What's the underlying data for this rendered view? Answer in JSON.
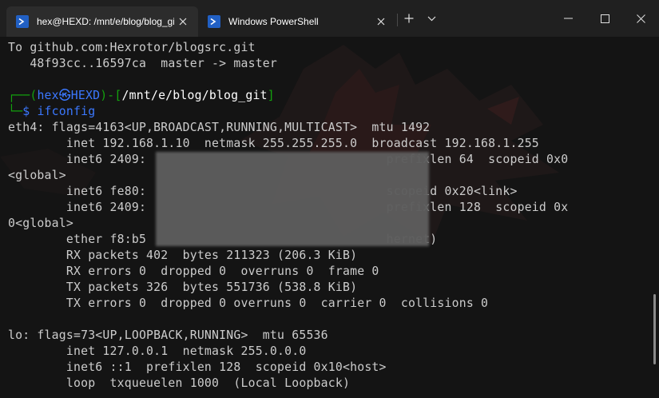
{
  "tabs": [
    {
      "title": "hex@HEXD: /mnt/e/blog/blog_git",
      "active": true,
      "icon": "terminal-icon"
    },
    {
      "title": "Windows PowerShell",
      "active": false,
      "icon": "powershell-icon"
    }
  ],
  "window_controls": [
    "new-tab-icon",
    "chevron-down-icon",
    "minimize-icon",
    "maximize-icon",
    "close-icon"
  ],
  "colors": {
    "accent": "#3b78ff",
    "prompt": "#16c60c",
    "titlebar": "#202020",
    "background": "#141414"
  },
  "terminal": {
    "lines": [
      "To github.com:Hexrotor/blogsrc.git",
      "   48f93cc..16597ca  master -> master",
      "",
      "eth4: flags=4163<UP,BROADCAST,RUNNING,MULTICAST>  mtu 1492",
      "        inet 192.168.1.10  netmask 255.255.255.0  broadcast 192.168.1.255",
      "        inet6 2409:                                 prefixlen 64  scopeid 0x0",
      "<global>",
      "        inet6 fe80:                                 scopeid 0x20<link>",
      "        inet6 2409:                                 prefixlen 128  scopeid 0x",
      "0<global>",
      "        ether f8:b5                                 hernet)",
      "        RX packets 402  bytes 211323 (206.3 KiB)",
      "        RX errors 0  dropped 0  overruns 0  frame 0",
      "        TX packets 326  bytes 551736 (538.8 KiB)",
      "        TX errors 0  dropped 0 overruns 0  carrier 0  collisions 0",
      "",
      "lo: flags=73<UP,LOOPBACK,RUNNING>  mtu 65536",
      "        inet 127.0.0.1  netmask 255.0.0.0",
      "        inet6 ::1  prefixlen 128  scopeid 0x10<host>",
      "        loop  txqueuelen 1000  (Local Loopback)"
    ],
    "prompt": {
      "corner_top": "┌──(",
      "user": "hex",
      "at_symbol": "㉿",
      "host": "HEXD",
      "mid": ")-[",
      "path": "/mnt/e/blog/blog_git",
      "close": "]",
      "corner_bottom": "└─",
      "dollar": "$",
      "command": "ifconfig"
    }
  }
}
